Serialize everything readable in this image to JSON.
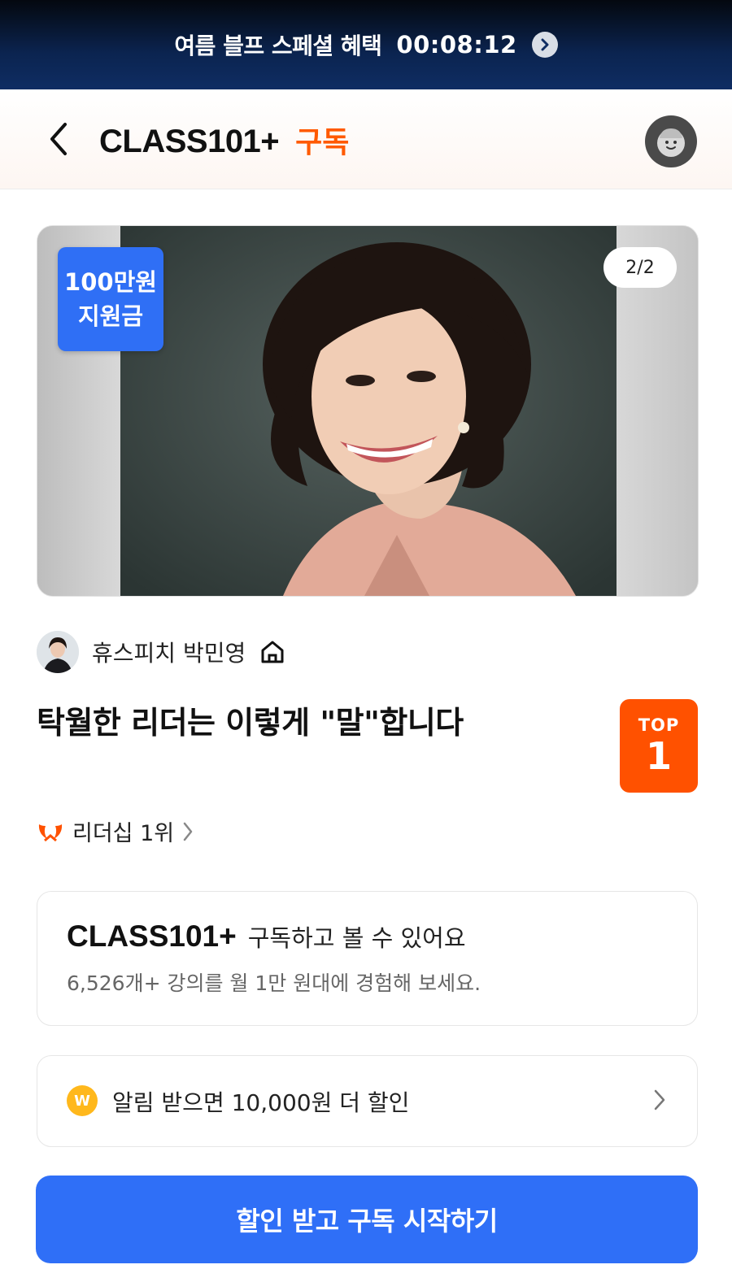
{
  "promo": {
    "title": "여름 블프 스페셜 혜택",
    "timer": "00:08:12"
  },
  "header": {
    "brand": "CLASS101+",
    "subtitle": "구독"
  },
  "hero": {
    "badge_line1": "100만원",
    "badge_line2": "지원금",
    "page_indicator": "2/2"
  },
  "creator": {
    "name": "휴스피치 박민영"
  },
  "course": {
    "title": "탁월한 리더는 이렇게 \"말\"합니다"
  },
  "top_badge": {
    "label": "TOP",
    "rank": "1"
  },
  "ranking": {
    "text": "리더십 1위"
  },
  "subscription": {
    "brand": "CLASS101+",
    "title": "구독하고 볼 수 있어요",
    "description": "6,526개+ 강의를 월 1만 원대에 경험해 보세요."
  },
  "notice": {
    "coin": "W",
    "text": "알림 받으면 10,000원 더 할인"
  },
  "cta": {
    "label": "할인 받고 구독 시작하기"
  },
  "colors": {
    "accent_orange": "#ff5100",
    "primary_blue": "#2f6ff7",
    "promo_navy": "#0f2d63"
  }
}
